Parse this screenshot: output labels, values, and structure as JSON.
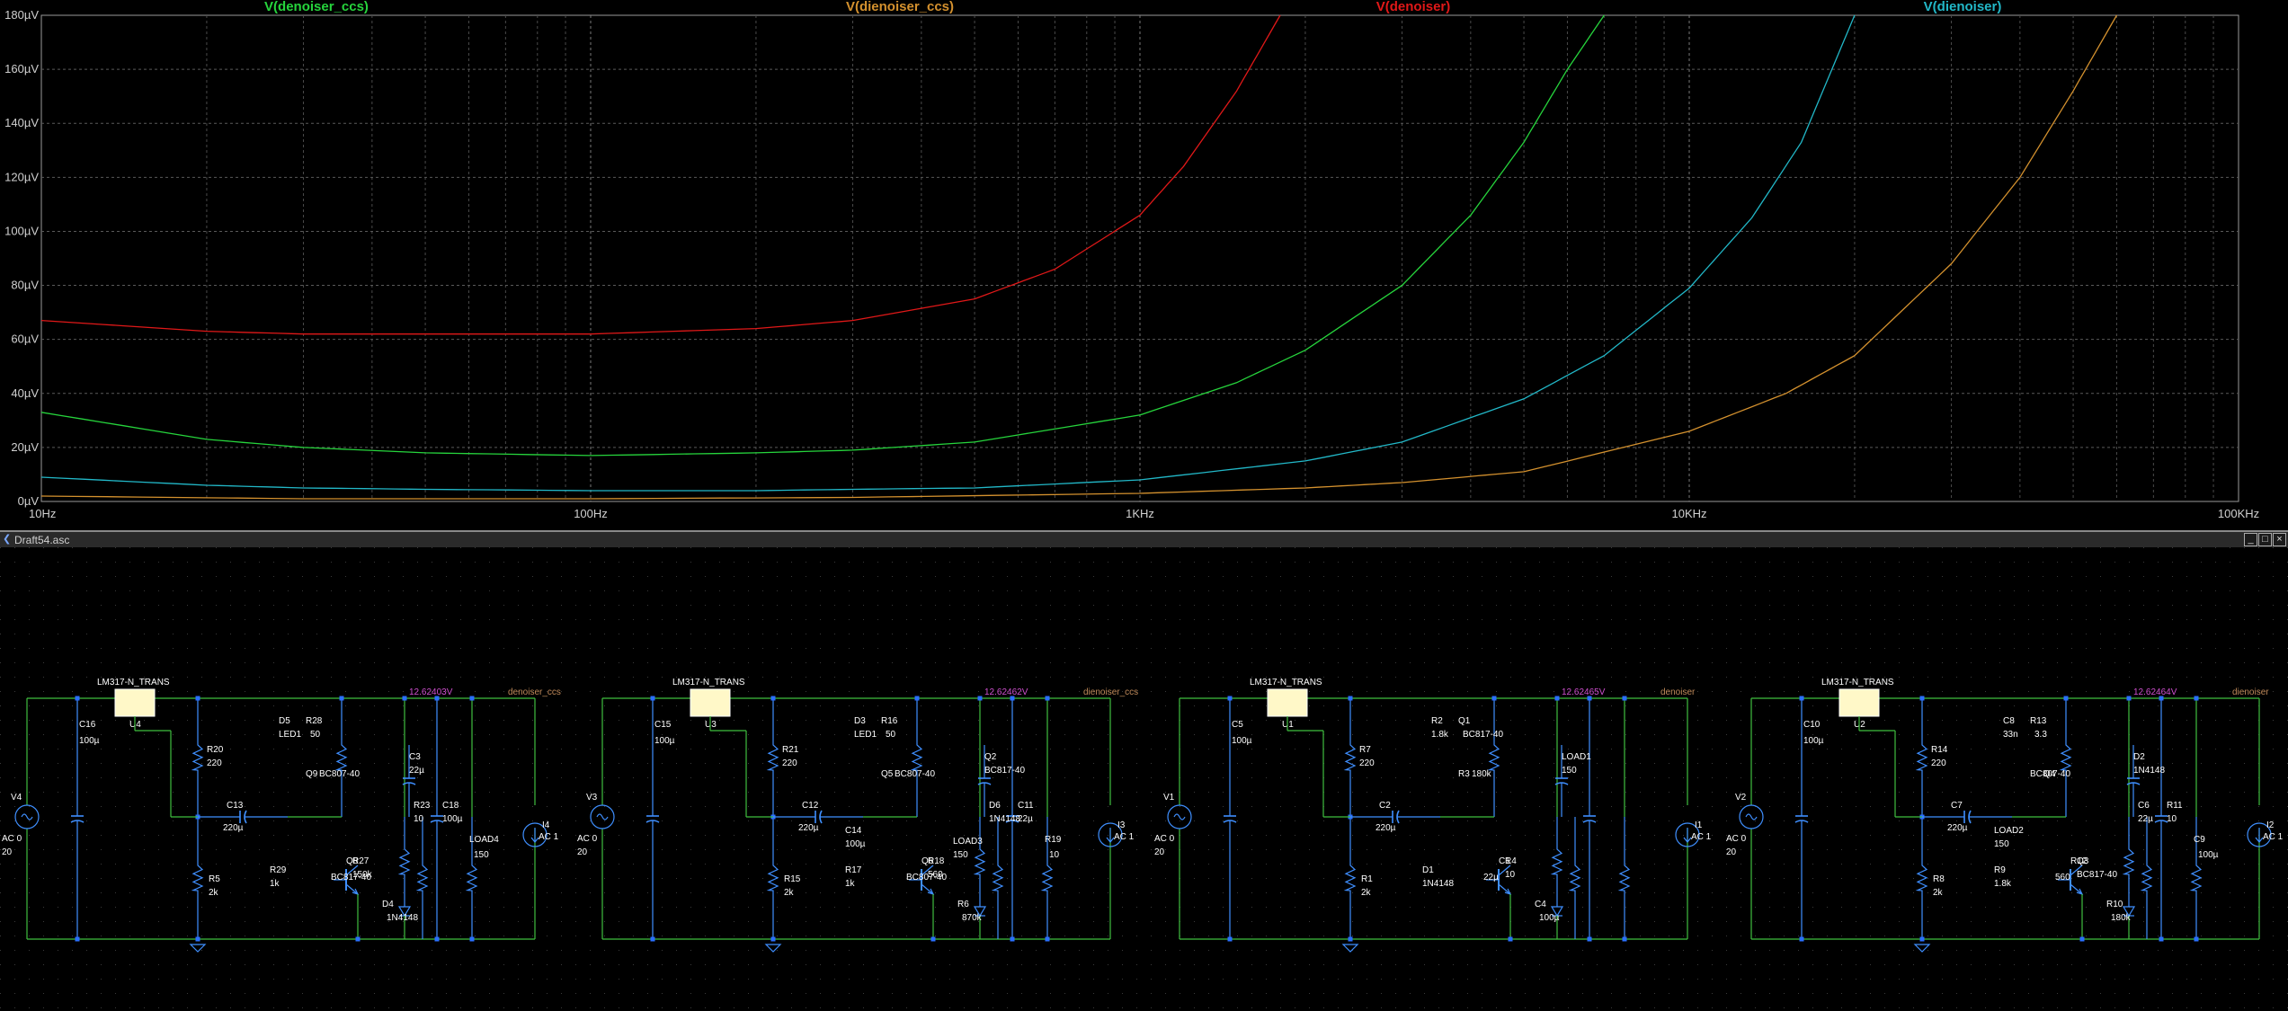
{
  "chart_data": {
    "type": "line",
    "x_scale": "log",
    "xlim": [
      10,
      100000
    ],
    "ylim": [
      0,
      180
    ],
    "y_unit": "µV",
    "grid": true,
    "y_ticks": [
      "0µV",
      "20µV",
      "40µV",
      "60µV",
      "80µV",
      "100µV",
      "120µV",
      "140µV",
      "160µV",
      "180µV"
    ],
    "x_ticks": [
      "10Hz",
      "100Hz",
      "1KHz",
      "10KHz",
      "100KHz"
    ],
    "series": [
      {
        "name": "V(denoiser_ccs)",
        "color": "#26d43c",
        "x": [
          10,
          20,
          30,
          50,
          100,
          200,
          300,
          500,
          1000,
          1500,
          2000,
          3000,
          4000,
          5000,
          6000,
          7000
        ],
        "y": [
          33,
          23,
          20,
          18,
          17,
          18,
          19,
          22,
          32,
          44,
          56,
          80,
          106,
          133,
          160,
          180
        ]
      },
      {
        "name": "V(dienoiser_ccs)",
        "color": "#d4912e",
        "x": [
          10,
          30,
          100,
          300,
          1000,
          2000,
          3000,
          5000,
          10000,
          15000,
          20000,
          30000,
          40000,
          50000,
          60000
        ],
        "y": [
          2,
          1,
          1,
          1.5,
          3,
          5,
          7,
          11,
          26,
          40,
          54,
          88,
          120,
          152,
          180
        ]
      },
      {
        "name": "V(denoiser)",
        "color": "#e01818",
        "x": [
          10,
          20,
          30,
          50,
          100,
          200,
          300,
          500,
          700,
          1000,
          1200,
          1500,
          1800
        ],
        "y": [
          67,
          63,
          62,
          62,
          62,
          64,
          67,
          75,
          86,
          106,
          124,
          152,
          180
        ]
      },
      {
        "name": "V(dienoiser)",
        "color": "#22b8c8",
        "x": [
          10,
          20,
          30,
          50,
          100,
          200,
          300,
          500,
          1000,
          2000,
          3000,
          5000,
          7000,
          10000,
          13000,
          16000,
          20000
        ],
        "y": [
          9,
          6,
          5,
          4.5,
          4,
          4,
          4.5,
          5,
          8,
          15,
          22,
          38,
          54,
          79,
          105,
          133,
          180
        ]
      }
    ]
  },
  "schematic": {
    "window_title": "Draft54.asc",
    "window_buttons": [
      "_",
      "□",
      "×"
    ],
    "circuits": [
      {
        "regulator": "LM317-N_TRANS",
        "reg_ref": "U4",
        "voltage": "12.62403V",
        "net": "denoiser_ccs",
        "source_ref": "V4",
        "source_val1": "AC 0",
        "source_val2": "20",
        "load_src_ref": "I4",
        "load_src_val": "AC 1",
        "parts": [
          {
            "t": "C16"
          },
          {
            "t": "100µ"
          },
          {
            "t": "R20"
          },
          {
            "t": "220"
          },
          {
            "t": "C13"
          },
          {
            "t": "220µ"
          },
          {
            "t": "R5"
          },
          {
            "t": "2k"
          },
          {
            "t": "D5"
          },
          {
            "t": "LED1"
          },
          {
            "t": "R28"
          },
          {
            "t": "50"
          },
          {
            "t": "Q9"
          },
          {
            "t": "BC807-40"
          },
          {
            "t": "R29"
          },
          {
            "t": "1k"
          },
          {
            "t": "Q8"
          },
          {
            "t": "BC817-40"
          },
          {
            "t": "R27"
          },
          {
            "t": "150k"
          },
          {
            "t": "D4"
          },
          {
            "t": "1N4148"
          },
          {
            "t": "C3"
          },
          {
            "t": "22µ"
          },
          {
            "t": "R23"
          },
          {
            "t": "10"
          },
          {
            "t": "C18"
          },
          {
            "t": "100µ"
          },
          {
            "t": "LOAD4"
          },
          {
            "t": "150"
          }
        ]
      },
      {
        "regulator": "LM317-N_TRANS",
        "reg_ref": "U3",
        "voltage": "12.62462V",
        "net": "dienoiser_ccs",
        "source_ref": "V3",
        "source_val1": "AC 0",
        "source_val2": "20",
        "load_src_ref": "I3",
        "load_src_val": "AC 1",
        "parts": [
          {
            "t": "C15"
          },
          {
            "t": "100µ"
          },
          {
            "t": "R21"
          },
          {
            "t": "220"
          },
          {
            "t": "C12"
          },
          {
            "t": "220µ"
          },
          {
            "t": "R15"
          },
          {
            "t": "2k"
          },
          {
            "t": "D3"
          },
          {
            "t": "LED1"
          },
          {
            "t": "R16"
          },
          {
            "t": "50"
          },
          {
            "t": "Q5"
          },
          {
            "t": "BC807-40"
          },
          {
            "t": "R17"
          },
          {
            "t": "1k"
          },
          {
            "t": "Q6"
          },
          {
            "t": "BC807-40"
          },
          {
            "t": "R18"
          },
          {
            "t": "560"
          },
          {
            "t": "R6"
          },
          {
            "t": "870k"
          },
          {
            "t": "Q2"
          },
          {
            "t": "BC817-40"
          },
          {
            "t": "D6"
          },
          {
            "t": "1N4148"
          },
          {
            "t": "C11"
          },
          {
            "t": "22µ"
          },
          {
            "t": "R19"
          },
          {
            "t": "10"
          },
          {
            "t": "C14"
          },
          {
            "t": "100µ"
          },
          {
            "t": "LOAD3"
          },
          {
            "t": "150"
          }
        ]
      },
      {
        "regulator": "LM317-N_TRANS",
        "reg_ref": "U1",
        "voltage": "12.62465V",
        "net": "denoiser",
        "source_ref": "V1",
        "source_val1": "AC 0",
        "source_val2": "20",
        "load_src_ref": "I1",
        "load_src_val": "AC 1",
        "parts": [
          {
            "t": "C5"
          },
          {
            "t": "100µ"
          },
          {
            "t": "R7"
          },
          {
            "t": "220"
          },
          {
            "t": "C2"
          },
          {
            "t": "220µ"
          },
          {
            "t": "R1"
          },
          {
            "t": "2k"
          },
          {
            "t": "R2"
          },
          {
            "t": "1.8k"
          },
          {
            "t": "Q1"
          },
          {
            "t": "BC817-40"
          },
          {
            "t": "R3"
          },
          {
            "t": "180k"
          },
          {
            "t": "D1"
          },
          {
            "t": "1N4148"
          },
          {
            "t": "C1"
          },
          {
            "t": "22µ"
          },
          {
            "t": "R4"
          },
          {
            "t": "10"
          },
          {
            "t": "C4"
          },
          {
            "t": "100µ"
          },
          {
            "t": "LOAD1"
          },
          {
            "t": "150"
          }
        ]
      },
      {
        "regulator": "LM317-N_TRANS",
        "reg_ref": "U2",
        "voltage": "12.62464V",
        "net": "dienoiser",
        "source_ref": "V2",
        "source_val1": "AC 0",
        "source_val2": "20",
        "load_src_ref": "I2",
        "load_src_val": "AC 1",
        "parts": [
          {
            "t": "C10"
          },
          {
            "t": "100µ"
          },
          {
            "t": "R14"
          },
          {
            "t": "220"
          },
          {
            "t": "C7"
          },
          {
            "t": "220µ"
          },
          {
            "t": "R8"
          },
          {
            "t": "2k"
          },
          {
            "t": "C8"
          },
          {
            "t": "33n"
          },
          {
            "t": "R13"
          },
          {
            "t": "3.3"
          },
          {
            "t": "BC807-40"
          },
          {
            "t": "Q4"
          },
          {
            "t": "R9"
          },
          {
            "t": "1.8k"
          },
          {
            "t": "R12"
          },
          {
            "t": "560"
          },
          {
            "t": "Q3"
          },
          {
            "t": "BC817-40"
          },
          {
            "t": "R10"
          },
          {
            "t": "180k"
          },
          {
            "t": "D2"
          },
          {
            "t": "1N4148"
          },
          {
            "t": "C6"
          },
          {
            "t": "22µ"
          },
          {
            "t": "R11"
          },
          {
            "t": "10"
          },
          {
            "t": "C9"
          },
          {
            "t": "100µ"
          },
          {
            "t": "LOAD2"
          },
          {
            "t": "150"
          }
        ]
      }
    ]
  }
}
